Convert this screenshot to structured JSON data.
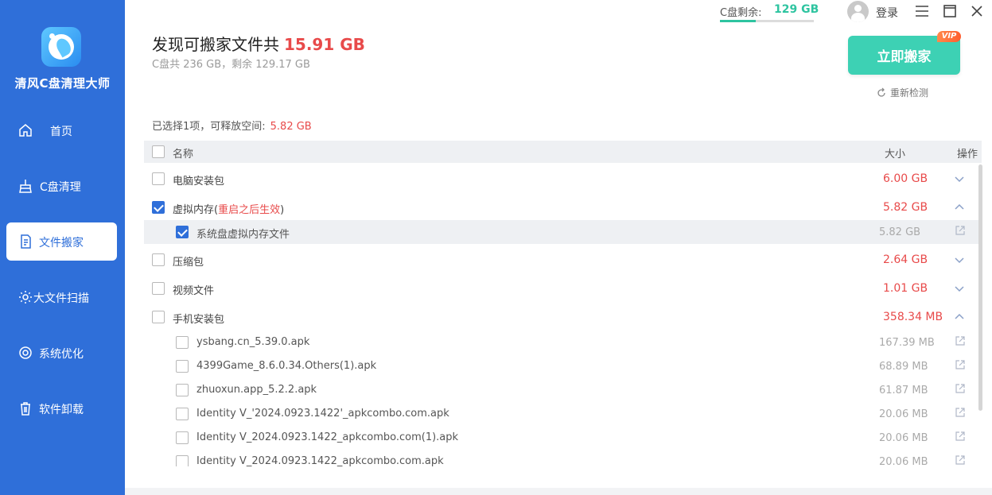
{
  "app": {
    "name": "清风C盘清理大师"
  },
  "sidebar": {
    "items": [
      {
        "label": "首页",
        "icon": "home-icon",
        "active": false
      },
      {
        "label": "C盘清理",
        "icon": "broom-icon",
        "active": false
      },
      {
        "label": "文件搬家",
        "icon": "file-move-icon",
        "active": true
      },
      {
        "label": "大文件扫描",
        "icon": "gear-scan-icon",
        "active": false
      },
      {
        "label": "系统优化",
        "icon": "gear-icon",
        "active": false
      },
      {
        "label": "软件卸载",
        "icon": "trash-icon",
        "active": false
      }
    ]
  },
  "topbar": {
    "disk_label": "C盘剩余:",
    "disk_value": "129 GB",
    "disk_fill_fraction": 0.38,
    "login": "登录"
  },
  "header": {
    "title": "发现可搬家文件共",
    "total": "15.91 GB",
    "subtitle": "C盘共 236 GB，剩余 129.17 GB",
    "move_button": "立即搬家",
    "vip": "VIP",
    "recheck": "重新检测"
  },
  "selection": {
    "text": "已选择1项，可释放空间:",
    "value": "5.82 GB"
  },
  "table": {
    "headers": {
      "name": "名称",
      "size": "大小",
      "action": "操作"
    },
    "groups": [
      {
        "name": "电脑安装包",
        "size": "6.00 GB",
        "checked": false,
        "expanded": false
      },
      {
        "name": "虚拟内存(",
        "note": "重启之后生效",
        "suffix": ")",
        "size": "5.82 GB",
        "checked": true,
        "expanded": true
      },
      {
        "name": "压缩包",
        "size": "2.64 GB",
        "checked": false,
        "expanded": false
      },
      {
        "name": "视频文件",
        "size": "1.01 GB",
        "checked": false,
        "expanded": false
      },
      {
        "name": "手机安装包",
        "size": "358.34 MB",
        "checked": false,
        "expanded": true
      }
    ],
    "virtual_memory_items": [
      {
        "name": "系统盘虚拟内存文件",
        "size": "5.82 GB",
        "checked": true
      }
    ],
    "apk_items": [
      {
        "name": "ysbang.cn_5.39.0.apk",
        "size": "167.39 MB",
        "checked": false
      },
      {
        "name": "4399Game_8.6.0.34.Others(1).apk",
        "size": "68.89 MB",
        "checked": false
      },
      {
        "name": "zhuoxun.app_5.2.2.apk",
        "size": "61.87 MB",
        "checked": false
      },
      {
        "name": "Identity V_'2024.0923.1422'_apkcombo.com.apk",
        "size": "20.06 MB",
        "checked": false
      },
      {
        "name": "Identity V_2024.0923.1422_apkcombo.com(1).apk",
        "size": "20.06 MB",
        "checked": false
      },
      {
        "name": "Identity V_2024.0923.1422_apkcombo.com.apk",
        "size": "20.06 MB",
        "checked": false
      }
    ]
  },
  "colors": {
    "sidebar": "#2f6fd9",
    "accent_green": "#3dd1b4",
    "danger": "#e84a4a"
  }
}
